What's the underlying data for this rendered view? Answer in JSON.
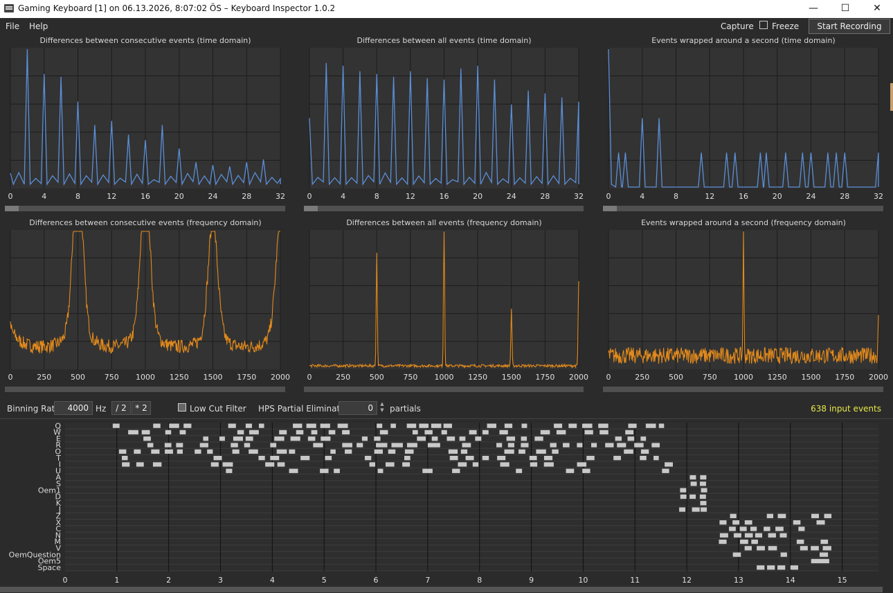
{
  "window": {
    "title": "Gaming Keyboard [1] on 06.13.2026, 8:07:02 ÖS – Keyboard Inspector 1.0.2",
    "minimize_glyph": "—",
    "maximize_glyph": "☐",
    "close_glyph": "✕"
  },
  "menu": {
    "file": "File",
    "help": "Help"
  },
  "toolbar": {
    "capture": "Capture",
    "freeze": "Freeze",
    "start_recording": "Start Recording"
  },
  "colors": {
    "time_series": "#5b8fd8",
    "freq_series": "#e38a1c",
    "plot_bg": "#333333",
    "grid": "#1c1c1c",
    "text_yellow": "#e8e84a",
    "blocks": "#c8c8c8"
  },
  "chart_data": [
    {
      "type": "line",
      "title": "Differences between consecutive events (time domain)",
      "x_ticks": [
        "0",
        "4",
        "8",
        "12",
        "16",
        "20",
        "24",
        "28",
        "32"
      ],
      "xlim": [
        0,
        32
      ],
      "series": [
        {
          "peaks_x": [
            0,
            2,
            4,
            6,
            8,
            10,
            12,
            14,
            16,
            18,
            20,
            22,
            24,
            26,
            28,
            30,
            32
          ],
          "peaks_h": [
            0.1,
            1.0,
            0.82,
            0.8,
            0.62,
            0.45,
            0.48,
            0.38,
            0.34,
            0.45,
            0.28,
            0.18,
            0.16,
            0.15,
            0.18,
            0.2,
            0.06
          ]
        }
      ]
    },
    {
      "type": "line",
      "title": "Differences between all events (time domain)",
      "x_ticks": [
        "0",
        "4",
        "8",
        "12",
        "16",
        "20",
        "24",
        "28",
        "32"
      ],
      "xlim": [
        0,
        32
      ],
      "series": [
        {
          "peaks_x": [
            0,
            2,
            4,
            6,
            8,
            10,
            12,
            14,
            16,
            18,
            20,
            22,
            24,
            26,
            28,
            30,
            32
          ],
          "peaks_h": [
            0.5,
            0.9,
            0.88,
            0.84,
            0.82,
            0.8,
            0.84,
            0.79,
            0.78,
            0.86,
            0.88,
            0.78,
            0.6,
            0.7,
            0.68,
            0.65,
            0.62
          ]
        }
      ]
    },
    {
      "type": "line",
      "title": "Events wrapped around a second (time domain)",
      "x_ticks": [
        "0",
        "4",
        "8",
        "12",
        "16",
        "20",
        "24",
        "28",
        "32"
      ],
      "xlim": [
        0,
        32
      ],
      "series": [
        {
          "peaks_x": [
            0,
            1.2,
            2,
            4,
            6,
            11,
            14,
            15,
            18,
            18.7,
            21,
            23,
            24,
            26,
            27,
            28,
            32
          ],
          "peaks_h": [
            1.0,
            0.25,
            0.25,
            0.5,
            0.5,
            0.25,
            0.25,
            0.25,
            0.25,
            0.25,
            0.25,
            0.25,
            0.25,
            0.25,
            0.25,
            0.25,
            0.25
          ]
        }
      ]
    },
    {
      "type": "line",
      "title": "Differences between consecutive events (frequency domain)",
      "x_ticks": [
        "0",
        "250",
        "500",
        "750",
        "1000",
        "1250",
        "1500",
        "1750",
        "2000"
      ],
      "xlim": [
        0,
        2000
      ],
      "series": [
        {
          "peaks_x": [
            500,
            1000,
            1500,
            2000
          ],
          "peaks_h": [
            1.0,
            0.88,
            0.67,
            0.65
          ],
          "noise": 0.1,
          "bump_width": 35
        }
      ]
    },
    {
      "type": "line",
      "title": "Differences between all events (frequency domain)",
      "x_ticks": [
        "0",
        "250",
        "500",
        "750",
        "1000",
        "1250",
        "1500",
        "1750",
        "2000"
      ],
      "xlim": [
        0,
        2000
      ],
      "series": [
        {
          "peaks_x": [
            500,
            1000,
            1500,
            2000
          ],
          "peaks_h": [
            0.83,
            1.0,
            0.42,
            0.62
          ],
          "noise": 0.02,
          "bump_width": 4
        }
      ]
    },
    {
      "type": "line",
      "title": "Events wrapped around a second (frequency domain)",
      "x_ticks": [
        "0",
        "250",
        "500",
        "750",
        "1000",
        "1250",
        "1500",
        "1750",
        "2000"
      ],
      "xlim": [
        0,
        2000
      ],
      "series": [
        {
          "peaks_x": [
            1000,
            2000
          ],
          "peaks_h": [
            1.0,
            0.26
          ],
          "noise": 0.12,
          "bump_width": 3
        }
      ]
    }
  ],
  "controls": {
    "binning_rate_label": "Binning Rate:",
    "binning_rate_value": "4000",
    "hz": "Hz",
    "half_btn": "/ 2",
    "double_btn": "* 2",
    "low_cut_label": "Low Cut Filter",
    "hps_label": "HPS Partial Elimination:",
    "hps_value": "0",
    "partials": "partials",
    "input_events": "638 input events"
  },
  "raster": {
    "key_labels": [
      "Q",
      "W",
      "E",
      "R",
      "O",
      "T",
      "I",
      "U",
      "A",
      "S",
      "Oem1",
      "D",
      "K",
      "J",
      "Z",
      "X",
      "C",
      "N",
      "M",
      "V",
      "OemQuestion",
      "Oem5",
      "Space"
    ],
    "x_ticks": [
      "0",
      "1",
      "2",
      "3",
      "4",
      "5",
      "6",
      "7",
      "8",
      "9",
      "10",
      "11",
      "12",
      "13",
      "14",
      "15"
    ],
    "xlim": [
      0,
      15.7
    ]
  }
}
